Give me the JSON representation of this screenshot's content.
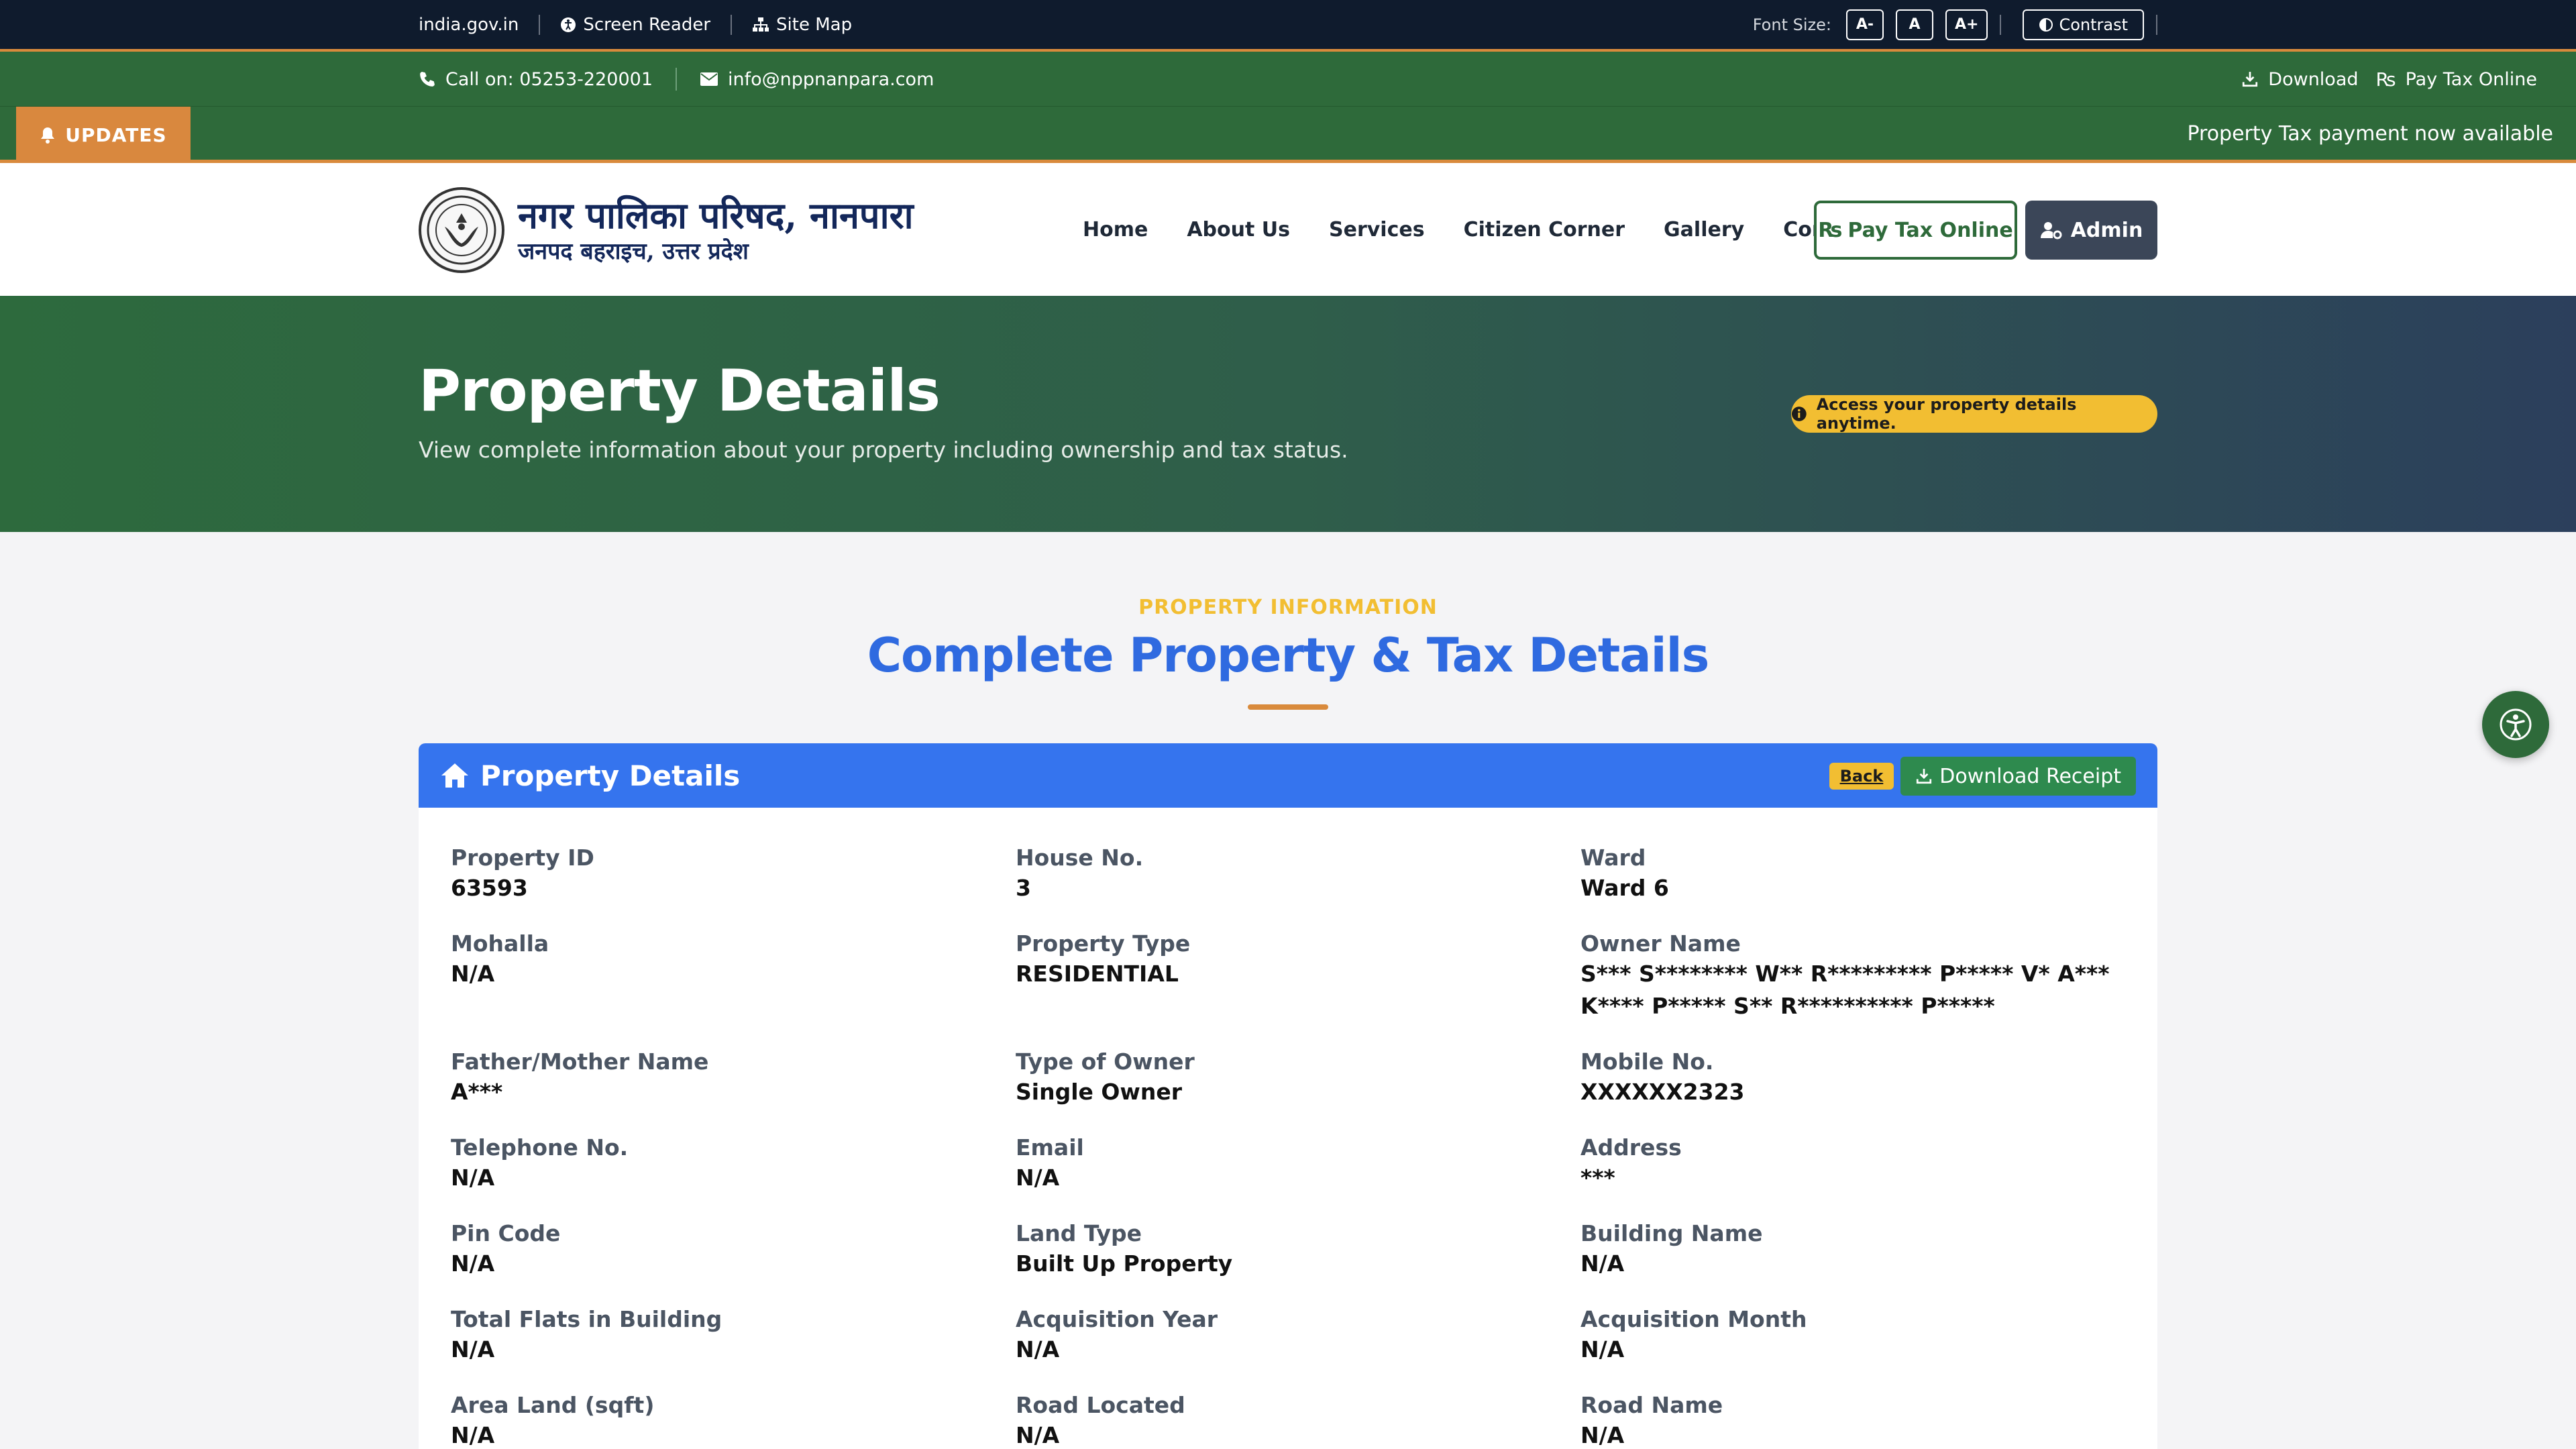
{
  "topbar": {
    "india_link": "india.gov.in",
    "screen_reader": "Screen Reader",
    "site_map": "Site Map",
    "font_size_label": "Font Size:",
    "font_small": "A-",
    "font_normal": "A",
    "font_large": "A+",
    "contrast": "Contrast"
  },
  "contact": {
    "phone": "Call on: 05253-220001",
    "email": "info@nppnanpara.com",
    "download": "Download",
    "pay_tax": "Pay Tax Online"
  },
  "updates": {
    "badge": "UPDATES",
    "ticker": "Property Tax payment now available"
  },
  "header": {
    "title_hindi": "नगर पालिका परिषद, नानपारा",
    "subtitle_hindi": "जनपद बहराइच, उत्तर प्रदेश",
    "nav": [
      "Home",
      "About Us",
      "Services",
      "Citizen Corner",
      "Gallery",
      "Contact"
    ],
    "pay_button": "Pay Tax Online",
    "admin_button": "Admin"
  },
  "hero": {
    "title": "Property Details",
    "description": "View complete information about your property including ownership and tax status.",
    "notice": "Access your property details anytime."
  },
  "section": {
    "eyebrow": "PROPERTY INFORMATION",
    "title": "Complete Property & Tax Details"
  },
  "card": {
    "title": "Property Details",
    "back": "Back",
    "download_receipt": "Download Receipt",
    "fields": [
      {
        "label": "Property ID",
        "value": "63593"
      },
      {
        "label": "House No.",
        "value": "3"
      },
      {
        "label": "Ward",
        "value": "Ward 6"
      },
      {
        "label": "Mohalla",
        "value": "N/A"
      },
      {
        "label": "Property Type",
        "value": "RESIDENTIAL"
      },
      {
        "label": "Owner Name",
        "value": "S*** S******** W** R********* P***** V* A*** K**** P***** S** R********** P*****"
      },
      {
        "label": "Father/Mother Name",
        "value": "A***"
      },
      {
        "label": "Type of Owner",
        "value": "Single Owner"
      },
      {
        "label": "Mobile No.",
        "value": "XXXXXX2323"
      },
      {
        "label": "Telephone No.",
        "value": "N/A"
      },
      {
        "label": "Email",
        "value": "N/A"
      },
      {
        "label": "Address",
        "value": "***"
      },
      {
        "label": "Pin Code",
        "value": "N/A"
      },
      {
        "label": "Land Type",
        "value": "Built Up Property"
      },
      {
        "label": "Building Name",
        "value": "N/A"
      },
      {
        "label": "Total Flats in Building",
        "value": "N/A"
      },
      {
        "label": "Acquisition Year",
        "value": "N/A"
      },
      {
        "label": "Acquisition Month",
        "value": "N/A"
      },
      {
        "label": "Area Land (sqft)",
        "value": "N/A"
      },
      {
        "label": "Road Located",
        "value": "N/A"
      },
      {
        "label": "Road Name",
        "value": "N/A"
      }
    ]
  },
  "colors": {
    "topbar": "#0f1b2d",
    "green": "#2e6a3a",
    "orange": "#d98a3c",
    "blue": "#3574ee",
    "yellow": "#f2be32"
  }
}
